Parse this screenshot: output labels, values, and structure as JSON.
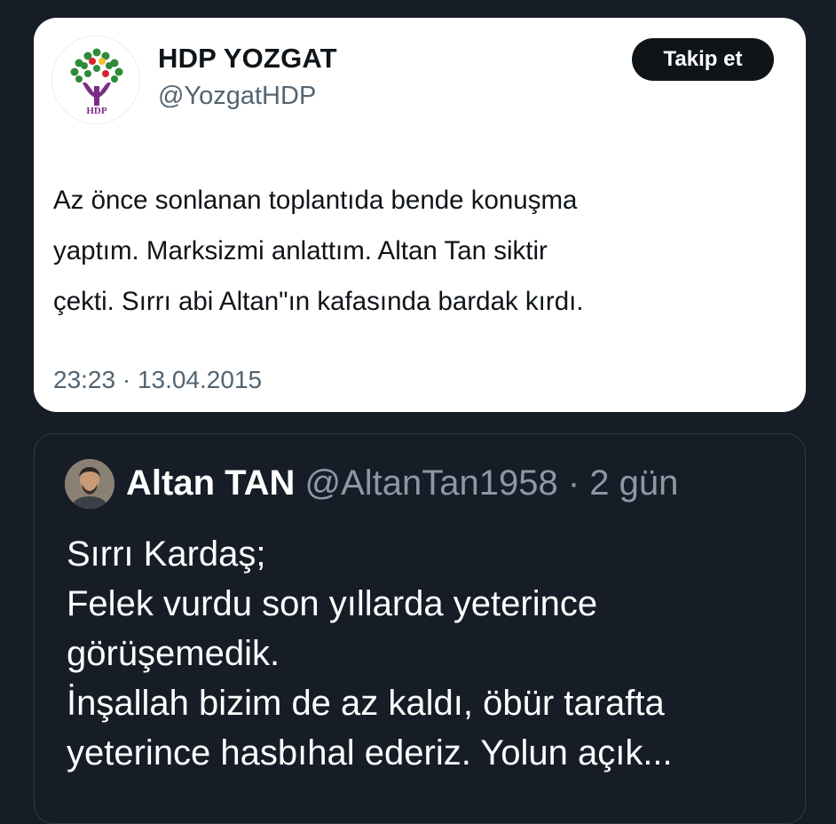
{
  "tweet": {
    "display_name": "HDP YOZGAT",
    "handle": "@YozgatHDP",
    "follow_label": "Takip et",
    "avatar_text": "HDP",
    "text_lines": [
      "Az önce sonlanan toplantıda bende konuşma",
      "yaptım. Marksizmi anlattım. Altan Tan siktir",
      "çekti. Sırrı abi Altan\"ın kafasında bardak kırdı."
    ],
    "timestamp": "23:23 · 13.04.2015"
  },
  "quote": {
    "display_name": "Altan TAN",
    "handle": "@AltanTan1958",
    "separator": " · ",
    "time": "2 gün",
    "text_lines": [
      "Sırrı Kardaş;",
      "Felek vurdu son yıllarda yeterince",
      "görüşemedik.",
      "İnşallah bizim de az kaldı, öbür tarafta",
      "yeterince hasbıhal ederiz. Yolun açık..."
    ]
  },
  "colors": {
    "background": "#161d27",
    "card": "#ffffff",
    "text_dark": "#0f1419",
    "text_muted": "#536471",
    "quote_border": "#2f3a47",
    "quote_meta": "#8b98a5",
    "logo_purple": "#7b2c86",
    "logo_green": "#2e8b3a",
    "logo_red": "#d8242c"
  },
  "icons": {
    "tweet_avatar": "hdp-tree-logo-icon",
    "quote_avatar": "person-avatar-icon"
  }
}
